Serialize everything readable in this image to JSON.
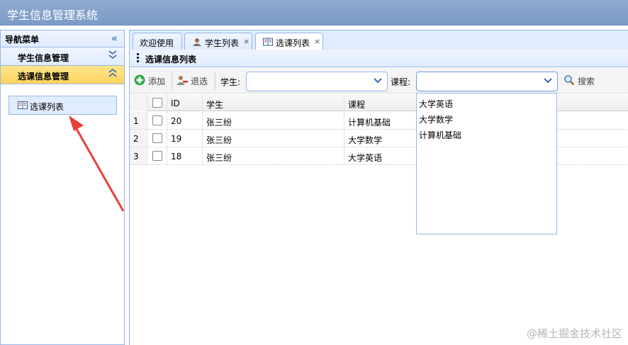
{
  "app": {
    "title": "学生信息管理系统"
  },
  "nav": {
    "header": "导航菜单",
    "collapse_icon": "double-chevron-left-icon",
    "sections": [
      {
        "label": "学生信息管理",
        "state": "collapsed"
      },
      {
        "label": "选课信息管理",
        "state": "expanded"
      }
    ],
    "items": [
      {
        "label": "选课列表",
        "icon": "book-icon"
      }
    ]
  },
  "tabs": [
    {
      "label": "欢迎使用",
      "closable": false
    },
    {
      "label": "学生列表",
      "closable": true,
      "icon": "user-icon"
    },
    {
      "label": "选课列表",
      "closable": true,
      "icon": "book-icon",
      "active": true
    }
  ],
  "tab_close_glyph": "×",
  "panel": {
    "title": "选课信息列表"
  },
  "toolbar": {
    "add_label": "添加",
    "drop_label": "退选",
    "student_label": "学生:",
    "course_label": "课程:",
    "search_label": "搜索"
  },
  "grid": {
    "columns": [
      "ID",
      "学生",
      "课程"
    ],
    "rows": [
      {
        "num": "1",
        "id": "20",
        "student": "张三纷",
        "course": "计算机基础"
      },
      {
        "num": "2",
        "id": "19",
        "student": "张三纷",
        "course": "大学数学"
      },
      {
        "num": "3",
        "id": "18",
        "student": "张三纷",
        "course": "大学英语"
      }
    ]
  },
  "course_dropdown": {
    "options": [
      "大学英语",
      "大学数学",
      "计算机基础"
    ]
  },
  "watermark": "@稀土掘金技术社区",
  "colors": {
    "titlebar": "#7c9bc7",
    "border": "#95b8e7",
    "active_section": "#ffd35f",
    "arrow": "#e8403a"
  }
}
